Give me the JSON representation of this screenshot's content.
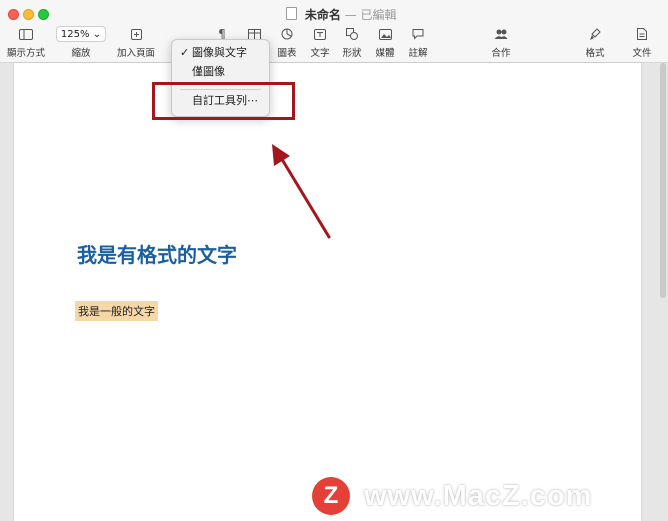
{
  "window": {
    "doc_name": "未命名",
    "separator": "—",
    "doc_state": "已編輯"
  },
  "toolbar": {
    "view_label": "顯示方式",
    "zoom_value": "125%",
    "zoom_label": "縮放",
    "add_page_label": "加入頁面",
    "chart_label": "圖表",
    "text_label": "文字",
    "shape_label": "形狀",
    "media_label": "媒體",
    "comment_label": "註解",
    "collab_label": "合作",
    "format_label": "格式",
    "document_label": "文件"
  },
  "context_menu": {
    "check_mark": "✓",
    "items": [
      "圖像與文字",
      "僅圖像",
      "自訂工具列⋯"
    ]
  },
  "document": {
    "heading": "我是有格式的文字",
    "body": "我是一般的文字"
  },
  "annotation": {
    "box_color": "#a5151c",
    "arrow_color": "#a5151c"
  },
  "watermark": {
    "logo_letter": "Z",
    "text": "www.MacZ.com"
  }
}
